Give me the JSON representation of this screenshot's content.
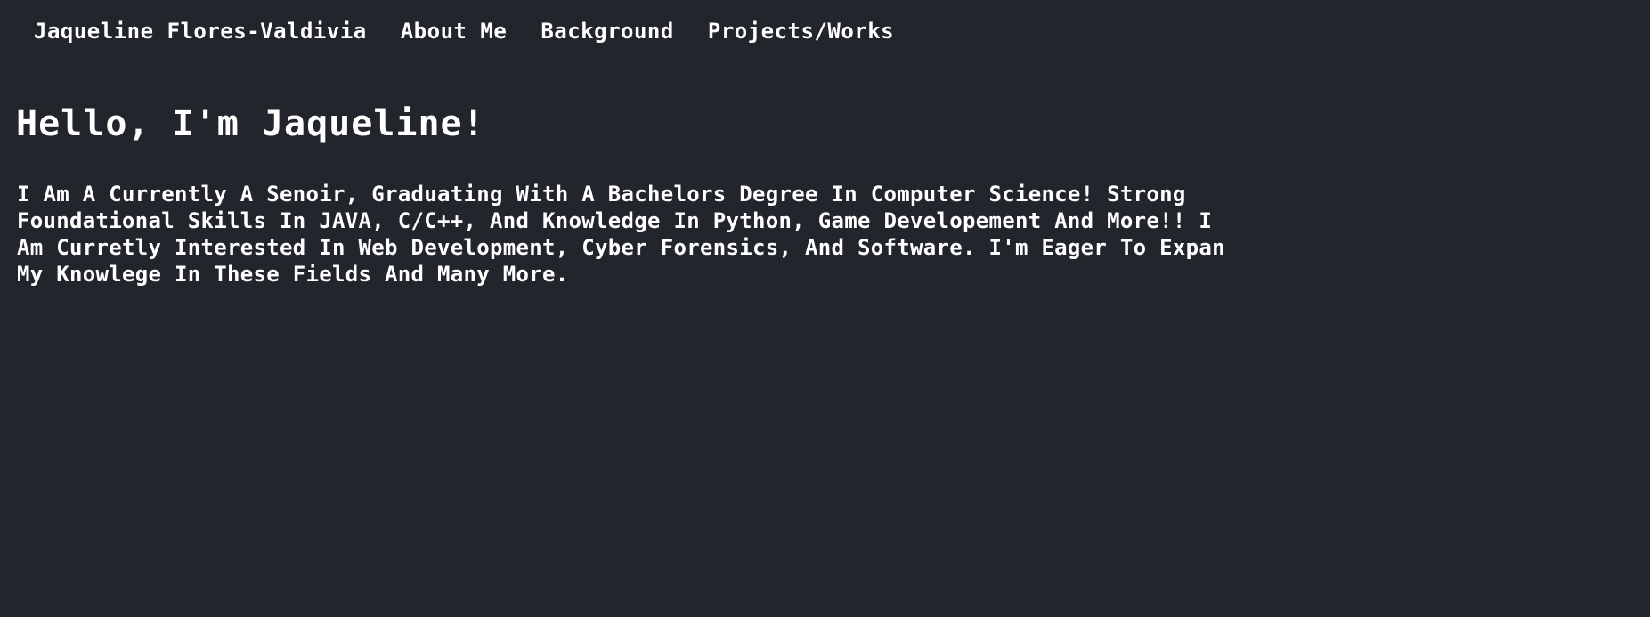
{
  "nav": {
    "brand": "Jaqueline Flores-Valdivia",
    "links": [
      {
        "label": "About Me"
      },
      {
        "label": "Background"
      },
      {
        "label": "Projects/Works"
      }
    ]
  },
  "main": {
    "heading": "Hello, I'm Jaqueline!",
    "intro_lines": [
      "I Am A Currently A Senoir, Graduating With A Bachelors Degree In Computer Science! Strong",
      "Foundational Skills In JAVA, C/C++, And Knowledge In Python, Game Developement And More!! I",
      "Am Curretly Interested In Web Development, Cyber Forensics, And Software. I'm Eager To Expan",
      "My Knowlege In These Fields And Many More."
    ]
  },
  "colors": {
    "background": "#22252b",
    "text": "#ffffff"
  }
}
